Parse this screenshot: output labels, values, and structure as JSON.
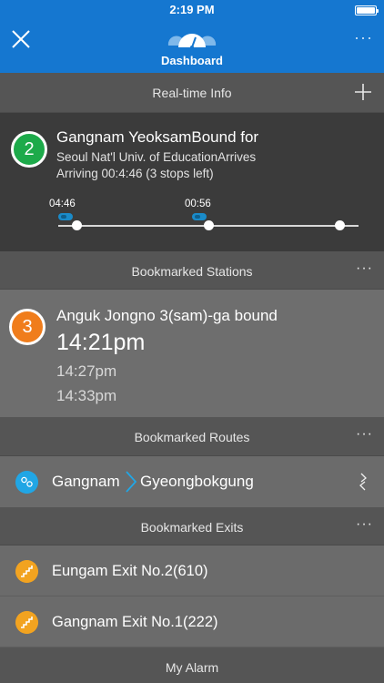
{
  "status_bar": {
    "time": "2:19 PM"
  },
  "nav": {
    "title": "Dashboard",
    "more": "···"
  },
  "realtime": {
    "header": "Real-time Info",
    "line_number": "2",
    "line_color": "#1daa4a",
    "title": "Gangnam YeoksamBound for",
    "destination": "Seoul Nat'l Univ. of EducationArrives",
    "arrival": "Arriving 00:4:46 (3 stops left)",
    "timeline_labels": [
      "04:46",
      "00:56"
    ]
  },
  "bookmarked_stations": {
    "header": "Bookmarked Stations",
    "more": "···",
    "line_number": "3",
    "line_color": "#f07d1c",
    "title": "Anguk Jongno 3(sam)-ga bound",
    "next_time": "14:21pm",
    "times": [
      "14:27pm",
      "14:33pm"
    ]
  },
  "bookmarked_routes": {
    "header": "Bookmarked Routes",
    "more": "···",
    "from": "Gangnam",
    "to": "Gyeongbokgung",
    "accent": "#21a6e5"
  },
  "bookmarked_exits": {
    "header": "Bookmarked Exits",
    "more": "···",
    "items": [
      {
        "label": "Eungam Exit No.2(610)"
      },
      {
        "label": "Gangnam Exit No.1(222)"
      }
    ],
    "accent": "#f2a320"
  },
  "my_alarm": {
    "header": "My Alarm"
  },
  "icons": [
    "close-icon",
    "dashboard-logo-icon",
    "more-icon",
    "plus-icon",
    "train-icon",
    "route-pin-icon",
    "chevron-right-icon",
    "swap-icon",
    "exit-stairs-icon"
  ],
  "colors": {
    "nav_blue": "#1577d0"
  }
}
